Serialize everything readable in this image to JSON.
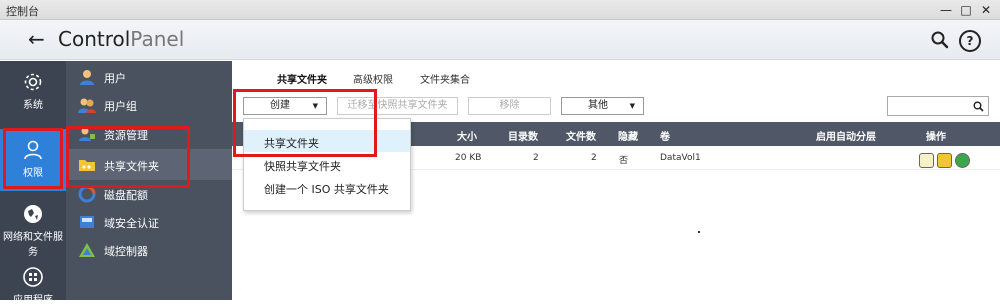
{
  "window": {
    "title": "控制台",
    "minimize": "—",
    "maximize": "□",
    "close": "✕"
  },
  "header": {
    "back_icon": "arrow-left-icon",
    "title_bold": "Control",
    "title_light": "Panel",
    "help_label": "?"
  },
  "rail": {
    "items": [
      {
        "label": "系统",
        "icon": "gear-icon"
      },
      {
        "label": "权限",
        "icon": "user-icon",
        "active": true
      },
      {
        "label": "网络和文件服务",
        "icon": "globe-icon"
      },
      {
        "label": "应用程序",
        "icon": "apps-icon"
      }
    ]
  },
  "subnav": {
    "items": [
      {
        "label": "用户"
      },
      {
        "label": "用户组"
      },
      {
        "label": "资源管理"
      },
      {
        "label": "共享文件夹",
        "active": true
      },
      {
        "label": "磁盘配额"
      },
      {
        "label": "域安全认证"
      },
      {
        "label": "域控制器"
      }
    ]
  },
  "tabs": [
    "共享文件夹",
    "高级权限",
    "文件夹集合"
  ],
  "toolbar": {
    "create": "创建",
    "migrate": "迁移至快照共享文件夹",
    "remove": "移除",
    "other": "其他",
    "filter_placeholder": ""
  },
  "table": {
    "headers": {
      "size": "大小",
      "dirs": "目录数",
      "files": "文件数",
      "hidden": "隐藏",
      "volume": "卷",
      "tiering": "启用自动分层",
      "ops": "操作"
    },
    "rows": [
      {
        "size": "20 KB",
        "dirs": "2",
        "files": "2",
        "hidden": "否",
        "volume": "DataVol1"
      }
    ]
  },
  "menu": {
    "items": [
      "共享文件夹",
      "快照共享文件夹",
      "创建一个 ISO 共享文件夹"
    ]
  },
  "colors": {
    "annotation": "#e0191f",
    "active_rail": "#2f80d8",
    "rail_bg": "#3c4452",
    "subnav_bg": "#4a5260",
    "header_row": "#505867"
  }
}
